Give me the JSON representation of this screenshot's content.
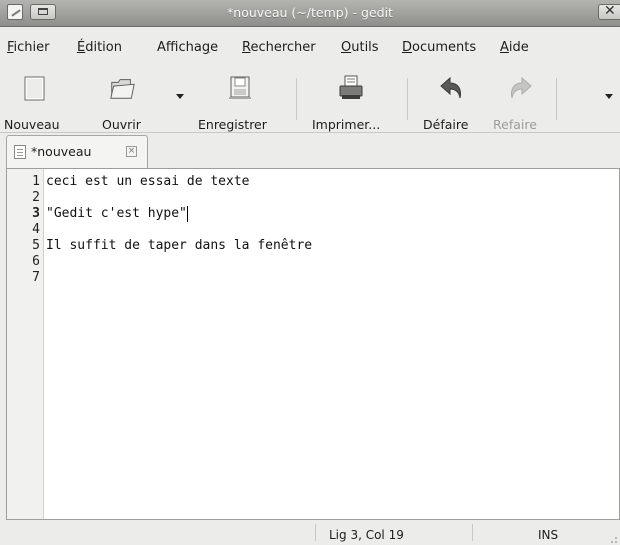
{
  "window": {
    "title": "*nouveau (~/temp) - gedit",
    "close_glyph": "✕"
  },
  "menu": [
    {
      "mnemonic": "F",
      "rest": "ichier"
    },
    {
      "mnemonic": "É",
      "rest": "dition"
    },
    {
      "pre": "Afficha",
      "mnemonic": "g",
      "rest": "e"
    },
    {
      "mnemonic": "R",
      "rest": "echercher"
    },
    {
      "mnemonic": "O",
      "rest": "utils"
    },
    {
      "mnemonic": "D",
      "rest": "ocuments"
    },
    {
      "mnemonic": "A",
      "rest": "ide"
    }
  ],
  "toolbar": {
    "new_label": "Nouveau",
    "open_label": "Ouvrir",
    "save_label": "Enregistrer",
    "print_label": "Imprimer...",
    "undo_label": "Défaire",
    "redo_label": "Refaire"
  },
  "tab": {
    "label": "*nouveau",
    "close_glyph": "×"
  },
  "editor": {
    "current_line": 3,
    "lines": [
      "ceci est un essai de texte",
      "",
      "\"Gedit c'est hype\"",
      "",
      "Il suffit de taper dans la fenêtre",
      "",
      ""
    ],
    "line_numbers": [
      "1",
      "2",
      "3",
      "4",
      "5",
      "6",
      "7"
    ]
  },
  "status": {
    "position": "Lig 3, Col 19",
    "mode": "INS"
  }
}
